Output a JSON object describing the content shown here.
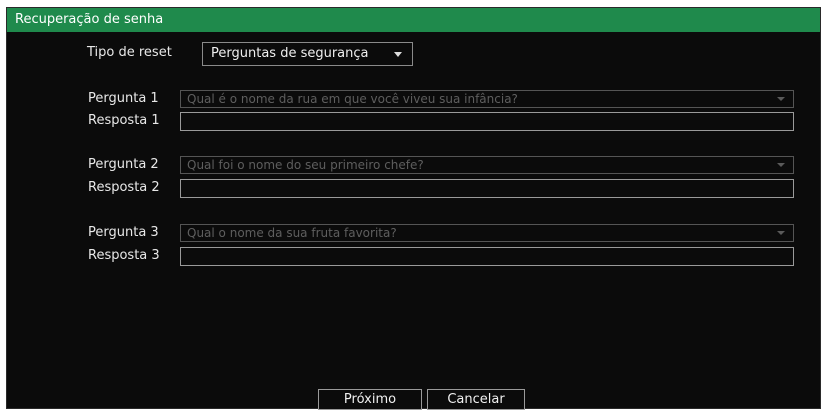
{
  "dialog": {
    "title": "Recuperação de senha"
  },
  "reset": {
    "label": "Tipo de reset",
    "value": "Perguntas de segurança"
  },
  "questions": [
    {
      "question_label": "Pergunta 1",
      "question_placeholder": "Qual é o nome da rua em que você viveu sua infância?",
      "answer_label": "Resposta 1",
      "answer_value": ""
    },
    {
      "question_label": "Pergunta 2",
      "question_placeholder": "Qual foi o nome do seu primeiro chefe?",
      "answer_label": "Resposta 2",
      "answer_value": ""
    },
    {
      "question_label": "Pergunta 3",
      "question_placeholder": "Qual o nome da sua fruta favorita?",
      "answer_label": "Resposta 3",
      "answer_value": ""
    }
  ],
  "buttons": {
    "next": "Próximo",
    "cancel": "Cancelar"
  },
  "colors": {
    "titlebar": "#1f8a4c",
    "background": "#0b0b0b"
  },
  "icons": {
    "dropdown": "chevron-down-icon"
  }
}
